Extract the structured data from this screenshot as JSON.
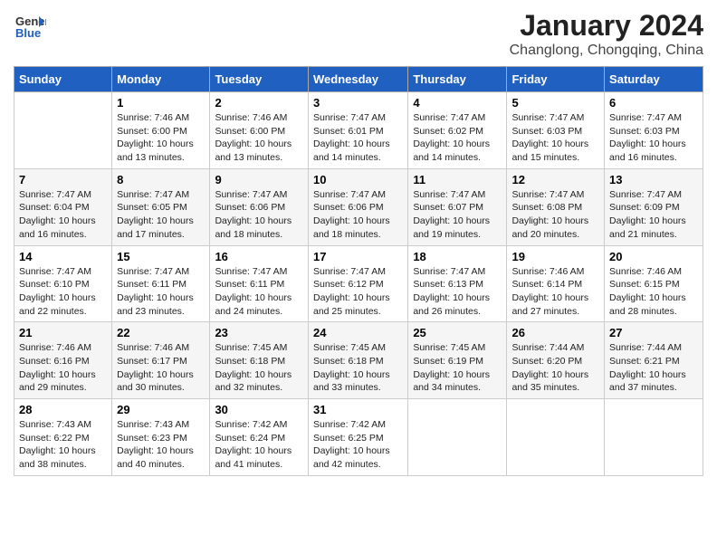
{
  "header": {
    "logo_line1": "General",
    "logo_line2": "Blue",
    "month": "January 2024",
    "location": "Changlong, Chongqing, China"
  },
  "days_of_week": [
    "Sunday",
    "Monday",
    "Tuesday",
    "Wednesday",
    "Thursday",
    "Friday",
    "Saturday"
  ],
  "weeks": [
    [
      {
        "day": "",
        "sunrise": "",
        "sunset": "",
        "daylight": ""
      },
      {
        "day": "1",
        "sunrise": "Sunrise: 7:46 AM",
        "sunset": "Sunset: 6:00 PM",
        "daylight": "Daylight: 10 hours and 13 minutes."
      },
      {
        "day": "2",
        "sunrise": "Sunrise: 7:46 AM",
        "sunset": "Sunset: 6:00 PM",
        "daylight": "Daylight: 10 hours and 13 minutes."
      },
      {
        "day": "3",
        "sunrise": "Sunrise: 7:47 AM",
        "sunset": "Sunset: 6:01 PM",
        "daylight": "Daylight: 10 hours and 14 minutes."
      },
      {
        "day": "4",
        "sunrise": "Sunrise: 7:47 AM",
        "sunset": "Sunset: 6:02 PM",
        "daylight": "Daylight: 10 hours and 14 minutes."
      },
      {
        "day": "5",
        "sunrise": "Sunrise: 7:47 AM",
        "sunset": "Sunset: 6:03 PM",
        "daylight": "Daylight: 10 hours and 15 minutes."
      },
      {
        "day": "6",
        "sunrise": "Sunrise: 7:47 AM",
        "sunset": "Sunset: 6:03 PM",
        "daylight": "Daylight: 10 hours and 16 minutes."
      }
    ],
    [
      {
        "day": "7",
        "sunrise": "Sunrise: 7:47 AM",
        "sunset": "Sunset: 6:04 PM",
        "daylight": "Daylight: 10 hours and 16 minutes."
      },
      {
        "day": "8",
        "sunrise": "Sunrise: 7:47 AM",
        "sunset": "Sunset: 6:05 PM",
        "daylight": "Daylight: 10 hours and 17 minutes."
      },
      {
        "day": "9",
        "sunrise": "Sunrise: 7:47 AM",
        "sunset": "Sunset: 6:06 PM",
        "daylight": "Daylight: 10 hours and 18 minutes."
      },
      {
        "day": "10",
        "sunrise": "Sunrise: 7:47 AM",
        "sunset": "Sunset: 6:06 PM",
        "daylight": "Daylight: 10 hours and 18 minutes."
      },
      {
        "day": "11",
        "sunrise": "Sunrise: 7:47 AM",
        "sunset": "Sunset: 6:07 PM",
        "daylight": "Daylight: 10 hours and 19 minutes."
      },
      {
        "day": "12",
        "sunrise": "Sunrise: 7:47 AM",
        "sunset": "Sunset: 6:08 PM",
        "daylight": "Daylight: 10 hours and 20 minutes."
      },
      {
        "day": "13",
        "sunrise": "Sunrise: 7:47 AM",
        "sunset": "Sunset: 6:09 PM",
        "daylight": "Daylight: 10 hours and 21 minutes."
      }
    ],
    [
      {
        "day": "14",
        "sunrise": "Sunrise: 7:47 AM",
        "sunset": "Sunset: 6:10 PM",
        "daylight": "Daylight: 10 hours and 22 minutes."
      },
      {
        "day": "15",
        "sunrise": "Sunrise: 7:47 AM",
        "sunset": "Sunset: 6:11 PM",
        "daylight": "Daylight: 10 hours and 23 minutes."
      },
      {
        "day": "16",
        "sunrise": "Sunrise: 7:47 AM",
        "sunset": "Sunset: 6:11 PM",
        "daylight": "Daylight: 10 hours and 24 minutes."
      },
      {
        "day": "17",
        "sunrise": "Sunrise: 7:47 AM",
        "sunset": "Sunset: 6:12 PM",
        "daylight": "Daylight: 10 hours and 25 minutes."
      },
      {
        "day": "18",
        "sunrise": "Sunrise: 7:47 AM",
        "sunset": "Sunset: 6:13 PM",
        "daylight": "Daylight: 10 hours and 26 minutes."
      },
      {
        "day": "19",
        "sunrise": "Sunrise: 7:46 AM",
        "sunset": "Sunset: 6:14 PM",
        "daylight": "Daylight: 10 hours and 27 minutes."
      },
      {
        "day": "20",
        "sunrise": "Sunrise: 7:46 AM",
        "sunset": "Sunset: 6:15 PM",
        "daylight": "Daylight: 10 hours and 28 minutes."
      }
    ],
    [
      {
        "day": "21",
        "sunrise": "Sunrise: 7:46 AM",
        "sunset": "Sunset: 6:16 PM",
        "daylight": "Daylight: 10 hours and 29 minutes."
      },
      {
        "day": "22",
        "sunrise": "Sunrise: 7:46 AM",
        "sunset": "Sunset: 6:17 PM",
        "daylight": "Daylight: 10 hours and 30 minutes."
      },
      {
        "day": "23",
        "sunrise": "Sunrise: 7:45 AM",
        "sunset": "Sunset: 6:18 PM",
        "daylight": "Daylight: 10 hours and 32 minutes."
      },
      {
        "day": "24",
        "sunrise": "Sunrise: 7:45 AM",
        "sunset": "Sunset: 6:18 PM",
        "daylight": "Daylight: 10 hours and 33 minutes."
      },
      {
        "day": "25",
        "sunrise": "Sunrise: 7:45 AM",
        "sunset": "Sunset: 6:19 PM",
        "daylight": "Daylight: 10 hours and 34 minutes."
      },
      {
        "day": "26",
        "sunrise": "Sunrise: 7:44 AM",
        "sunset": "Sunset: 6:20 PM",
        "daylight": "Daylight: 10 hours and 35 minutes."
      },
      {
        "day": "27",
        "sunrise": "Sunrise: 7:44 AM",
        "sunset": "Sunset: 6:21 PM",
        "daylight": "Daylight: 10 hours and 37 minutes."
      }
    ],
    [
      {
        "day": "28",
        "sunrise": "Sunrise: 7:43 AM",
        "sunset": "Sunset: 6:22 PM",
        "daylight": "Daylight: 10 hours and 38 minutes."
      },
      {
        "day": "29",
        "sunrise": "Sunrise: 7:43 AM",
        "sunset": "Sunset: 6:23 PM",
        "daylight": "Daylight: 10 hours and 40 minutes."
      },
      {
        "day": "30",
        "sunrise": "Sunrise: 7:42 AM",
        "sunset": "Sunset: 6:24 PM",
        "daylight": "Daylight: 10 hours and 41 minutes."
      },
      {
        "day": "31",
        "sunrise": "Sunrise: 7:42 AM",
        "sunset": "Sunset: 6:25 PM",
        "daylight": "Daylight: 10 hours and 42 minutes."
      },
      {
        "day": "",
        "sunrise": "",
        "sunset": "",
        "daylight": ""
      },
      {
        "day": "",
        "sunrise": "",
        "sunset": "",
        "daylight": ""
      },
      {
        "day": "",
        "sunrise": "",
        "sunset": "",
        "daylight": ""
      }
    ]
  ]
}
